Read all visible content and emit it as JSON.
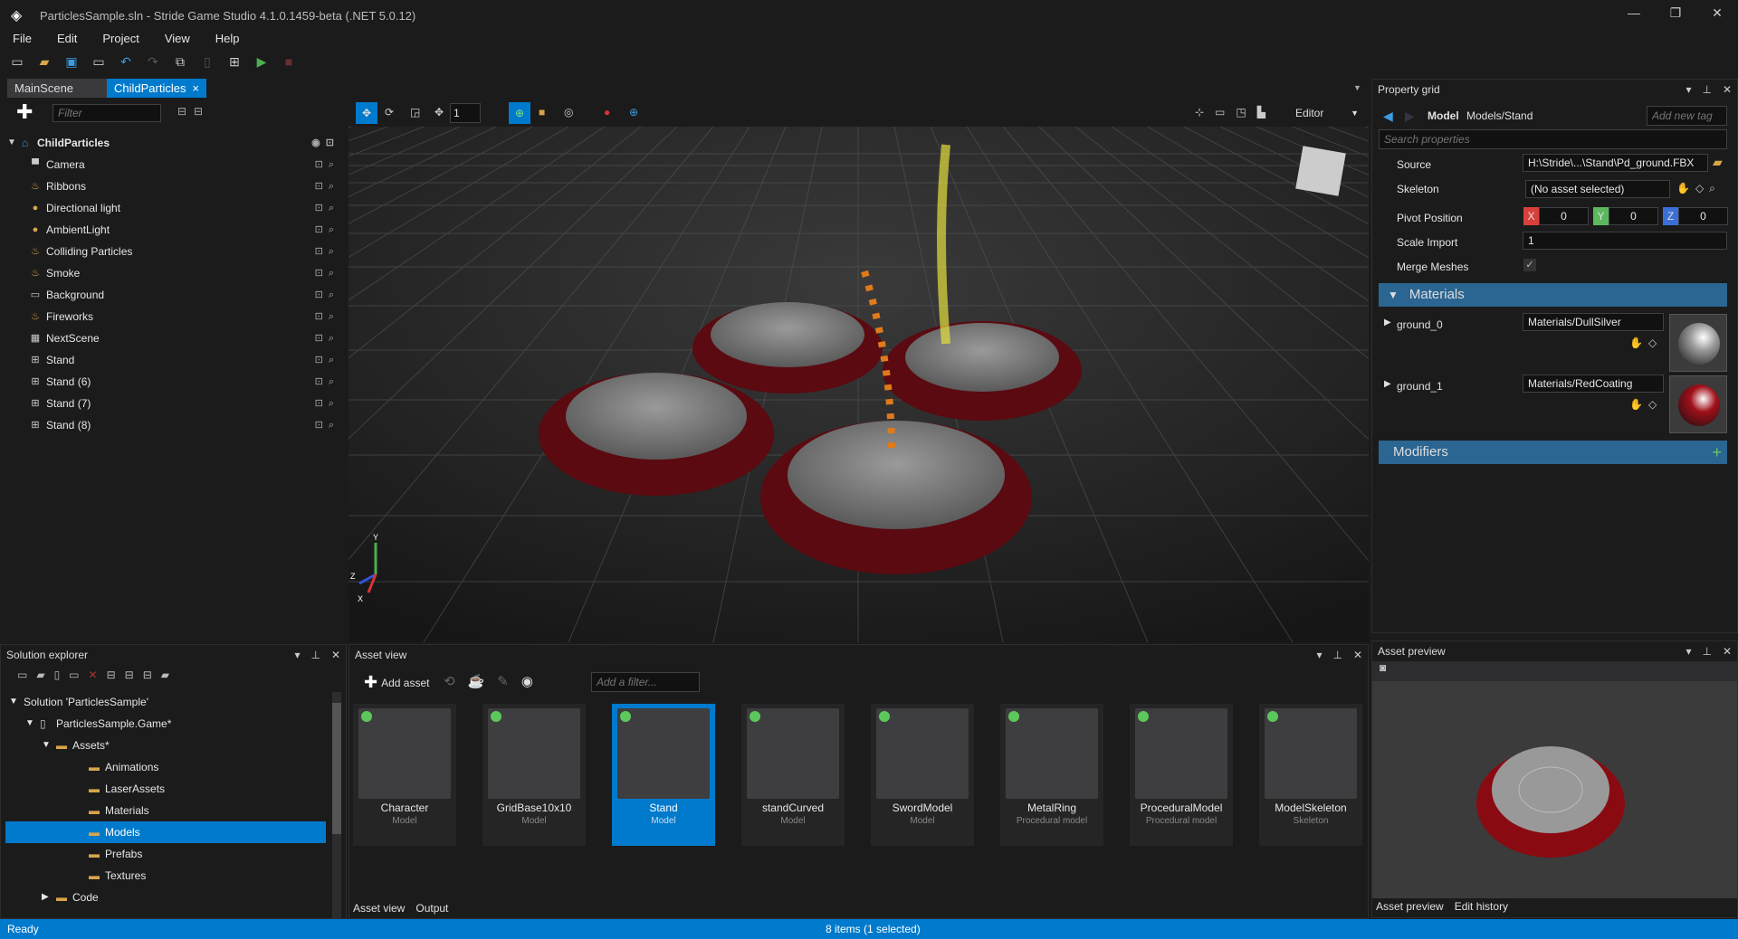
{
  "window": {
    "title": "ParticlesSample.sln - Stride Game Studio 4.1.0.1459-beta (.NET 5.0.12)",
    "minimize": "—",
    "restore": "❐",
    "close": "✕"
  },
  "menu": [
    "File",
    "Edit",
    "Project",
    "View",
    "Help"
  ],
  "tabs": [
    {
      "label": "MainScene"
    },
    {
      "label": "ChildParticles *",
      "close": "×"
    }
  ],
  "scene": {
    "filter_placeholder": "Filter",
    "root": "ChildParticles",
    "items": [
      {
        "label": "Camera",
        "icon": "camera-icon"
      },
      {
        "label": "Ribbons",
        "icon": "particles-icon"
      },
      {
        "label": "Directional light",
        "icon": "light-icon"
      },
      {
        "label": "AmbientLight",
        "icon": "light-icon"
      },
      {
        "label": "Colliding Particles",
        "icon": "particles-icon"
      },
      {
        "label": "Smoke",
        "icon": "particles-icon"
      },
      {
        "label": "Background",
        "icon": "background-icon"
      },
      {
        "label": "Fireworks",
        "icon": "particles-icon"
      },
      {
        "label": "NextScene",
        "icon": "scene-icon"
      },
      {
        "label": "Stand",
        "icon": "entity-icon"
      },
      {
        "label": "Stand (6)",
        "icon": "entity-icon"
      },
      {
        "label": "Stand (7)",
        "icon": "entity-icon"
      },
      {
        "label": "Stand (8)",
        "icon": "entity-icon"
      }
    ]
  },
  "viewport": {
    "snap_value": "1",
    "camera_mode": "Editor",
    "axes": {
      "x": "X",
      "y": "Y",
      "z": "Z"
    }
  },
  "property_grid": {
    "title": "Property grid",
    "asset_type": "Model",
    "asset_path": "Models/Stand",
    "tag_placeholder": "Add new tag",
    "search_placeholder": "Search properties",
    "source_label": "Source",
    "source": "H:\\Stride\\...\\Stand\\Pd_ground.FBX",
    "skeleton_label": "Skeleton",
    "skeleton": "(No asset selected)",
    "pivot_label": "Pivot Position",
    "pivot": {
      "x_label": "X",
      "x": "0",
      "y_label": "Y",
      "y": "0",
      "z_label": "Z",
      "z": "0"
    },
    "scale_label": "Scale Import",
    "scale": "1",
    "merge_label": "Merge Meshes",
    "merge_checked": true,
    "materials_header": "Materials",
    "materials": [
      {
        "name": "ground_0",
        "value": "Materials/DullSilver",
        "color": "#9a9a9a"
      },
      {
        "name": "ground_1",
        "value": "Materials/RedCoating",
        "color": "#a0101a"
      }
    ],
    "modifiers_header": "Modifiers"
  },
  "solution": {
    "title": "Solution explorer",
    "items": [
      {
        "label": "Solution 'ParticlesSample'",
        "depth": 0,
        "arrow": "▼"
      },
      {
        "label": "ParticlesSample.Game*",
        "depth": 1,
        "arrow": "▼"
      },
      {
        "label": "Assets*",
        "depth": 2,
        "arrow": "▼"
      },
      {
        "label": "Animations",
        "depth": 3
      },
      {
        "label": "LaserAssets",
        "depth": 3
      },
      {
        "label": "Materials",
        "depth": 3
      },
      {
        "label": "Models",
        "depth": 3,
        "selected": true
      },
      {
        "label": "Prefabs",
        "depth": 3
      },
      {
        "label": "Textures",
        "depth": 3
      },
      {
        "label": "Code",
        "depth": 2,
        "arrow": "▶"
      }
    ]
  },
  "asset_view": {
    "title": "Asset view",
    "add_asset": "Add asset",
    "filter_placeholder": "Add a filter...",
    "assets": [
      {
        "name": "Character",
        "type": "Model"
      },
      {
        "name": "GridBase10x10",
        "type": "Model"
      },
      {
        "name": "Stand",
        "type": "Model",
        "selected": true
      },
      {
        "name": "standCurved",
        "type": "Model"
      },
      {
        "name": "SwordModel",
        "type": "Model"
      },
      {
        "name": "MetalRing",
        "type": "Procedural model"
      },
      {
        "name": "ProceduralModel",
        "type": "Procedural model"
      },
      {
        "name": "ModelSkeleton",
        "type": "Skeleton"
      }
    ],
    "bottom_tabs": [
      "Asset view",
      "Output"
    ]
  },
  "asset_preview": {
    "title": "Asset preview",
    "bottom_tabs": [
      "Asset preview",
      "Edit history"
    ]
  },
  "status": {
    "left": "Ready",
    "center": "8 items (1 selected)"
  },
  "colors": {
    "accent": "#007acc",
    "section": "#2b6592",
    "status_dot": "#5cc85c"
  }
}
